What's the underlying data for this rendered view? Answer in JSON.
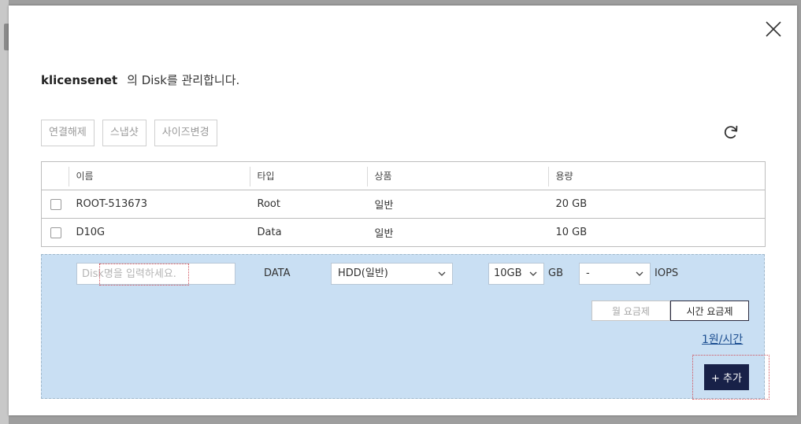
{
  "header": {
    "host_name": "klicensenet",
    "description": "의 Disk를 관리합니다."
  },
  "toolbar": {
    "detach_label": "연결해제",
    "snapshot_label": "스냅샷",
    "resize_label": "사이즈변경"
  },
  "table": {
    "columns": [
      "이름",
      "타입",
      "상품",
      "용량"
    ],
    "rows": [
      {
        "name": "ROOT-513673",
        "type": "Root",
        "product": "일반",
        "size": "20 GB"
      },
      {
        "name": "D10G",
        "type": "Data",
        "product": "일반",
        "size": "10 GB"
      }
    ]
  },
  "add_form": {
    "name_placeholder": "Disk명을 입력하세요.",
    "type_label": "DATA",
    "product_value": "HDD(일반)",
    "size_value": "10GB",
    "size_unit": "GB",
    "iops_value": "-",
    "iops_unit": "IOPS",
    "billing_month_label": "월 요금제",
    "billing_hour_label": "시간 요금제",
    "billing_selected": "시간 요금제",
    "price_text": "1원/시간",
    "add_label": "+ 추가"
  },
  "icons": {
    "close": "close-icon",
    "refresh": "refresh-icon",
    "dropdown": "chevron-down-icon"
  },
  "colors": {
    "panel_bg": "#c9dff3",
    "primary_button": "#182148",
    "link": "#1d4f91"
  }
}
